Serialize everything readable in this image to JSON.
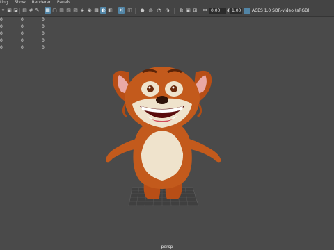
{
  "menubar": {
    "items": [
      "ting",
      "Show",
      "Renderer",
      "Panels"
    ]
  },
  "toolbar": {
    "left_icons": [
      "camera-select-icon",
      "camera-attributes-icon",
      "bookmark-icon",
      "image-plane-icon",
      "grid-icon",
      "film-gate-icon",
      "resolution-gate-icon",
      "gate-mask-icon",
      "field-chart-icon",
      "safe-action-icon",
      "safe-title-icon",
      "wireframe-icon",
      "smooth-shade-icon",
      "textured-icon",
      "lights-icon",
      "shadows-icon",
      "xray-icon",
      "isolate-select-icon",
      "ambient-occlusion-icon",
      "motion-blur-icon",
      "anti-alias-icon",
      "depth-of-field-icon",
      "settings-icon"
    ],
    "exposure_value": "0.00",
    "gamma_value": "1.00",
    "color_space": "ACES 1.0 SDR-video (sRGB)"
  },
  "hud": {
    "rows": [
      [
        "0",
        "0",
        "0"
      ],
      [
        "0",
        "0",
        "0"
      ],
      [
        "0",
        "0",
        "0"
      ],
      [
        "0",
        "0",
        "0"
      ],
      [
        "0",
        "0",
        "0"
      ]
    ]
  },
  "viewport": {
    "camera": "persp",
    "background": "#4a4a4a"
  }
}
